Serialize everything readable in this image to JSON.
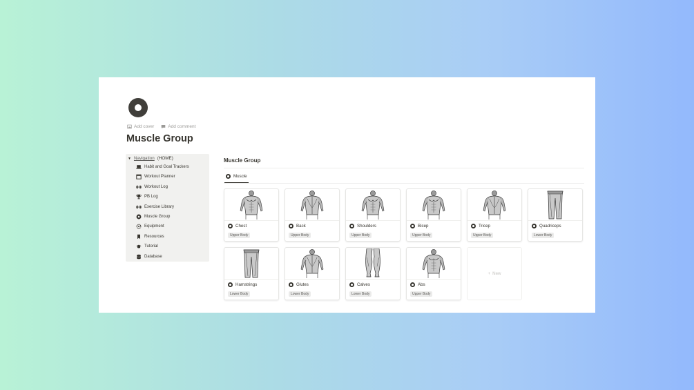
{
  "page": {
    "add_cover": "Add cover",
    "add_comment": "Add comment",
    "title": "Muscle Group"
  },
  "nav": {
    "header_link": "Navigation",
    "header_suffix": "(HOME)",
    "items": [
      {
        "label": "Habit and Goal Trackers",
        "icon": "device-icon"
      },
      {
        "label": "Workout Planner",
        "icon": "calendar-icon"
      },
      {
        "label": "Workout Log",
        "icon": "dumbbell-icon"
      },
      {
        "label": "PB Log",
        "icon": "trophy-icon"
      },
      {
        "label": "Exercise Library",
        "icon": "dumbbell-icon"
      },
      {
        "label": "Muscle Group",
        "icon": "disc-icon"
      },
      {
        "label": "Equipment",
        "icon": "gear-icon"
      },
      {
        "label": "Resources",
        "icon": "bookmark-icon"
      },
      {
        "label": "Tutorial",
        "icon": "graduation-cap-icon"
      },
      {
        "label": "Database",
        "icon": "database-icon"
      }
    ]
  },
  "database": {
    "title": "Muscle Group",
    "tab_label": "Muscle",
    "new_label": "New",
    "cards": [
      {
        "name": "Chest",
        "tag": "Upper Body"
      },
      {
        "name": "Back",
        "tag": "Upper Body"
      },
      {
        "name": "Shoulders",
        "tag": "Upper Body"
      },
      {
        "name": "Bicep",
        "tag": "Upper Body"
      },
      {
        "name": "Tricep",
        "tag": "Upper Body"
      },
      {
        "name": "Quadriceps",
        "tag": "Lower Body"
      },
      {
        "name": "Hamstrings",
        "tag": "Lower Body"
      },
      {
        "name": "Glutes",
        "tag": "Lower Body"
      },
      {
        "name": "Calves",
        "tag": "Lower Body"
      },
      {
        "name": "Abs",
        "tag": "Upper Body"
      }
    ]
  }
}
